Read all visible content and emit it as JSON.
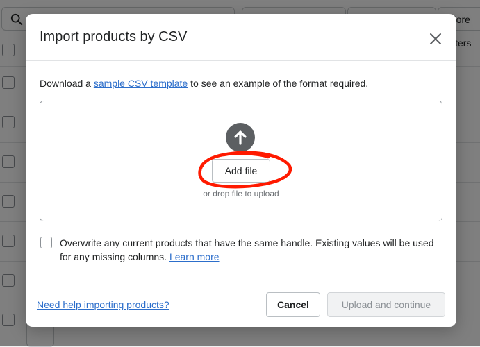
{
  "background": {
    "more_filters_label": "More filters"
  },
  "modal": {
    "title": "Import products by CSV",
    "intro": {
      "prefix": "Download a",
      "link": "sample CSV template",
      "suffix": "to see an example of the format required."
    },
    "dropzone": {
      "add_file_label": "Add file",
      "hint": "or drop file to upload"
    },
    "overwrite": {
      "text": "Overwrite any current products that have the same handle. Existing values will be used for any missing columns.",
      "link": "Learn more",
      "checked": false
    },
    "footer": {
      "help_link": "Need help importing products?",
      "cancel_label": "Cancel",
      "upload_label": "Upload and continue"
    }
  },
  "icons": {
    "search": "search-icon",
    "close": "close-icon",
    "upload": "arrow-up-icon"
  },
  "colors": {
    "link": "#2c6ecb",
    "annotation": "#ff1a00",
    "icon_dark": "#5c5f62"
  }
}
